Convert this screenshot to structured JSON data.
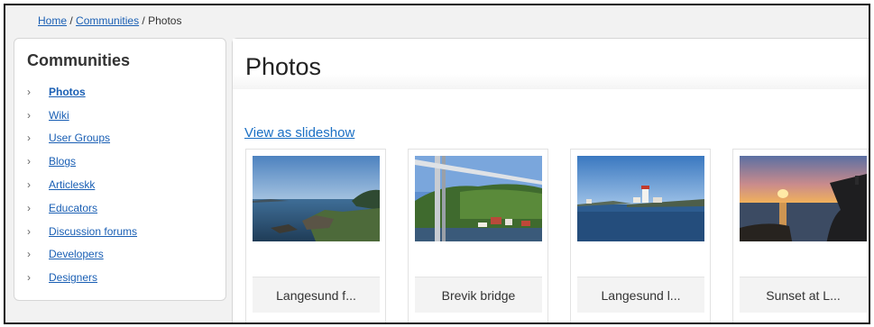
{
  "breadcrumb": {
    "home": "Home",
    "sep1": "/",
    "communities": "Communities",
    "sep2": "/",
    "current": "Photos"
  },
  "sidebar": {
    "title": "Communities",
    "items": [
      {
        "label": "Photos",
        "active": true
      },
      {
        "label": "Wiki"
      },
      {
        "label": "User Groups"
      },
      {
        "label": "Blogs"
      },
      {
        "label": "Articleskk"
      },
      {
        "label": "Educators"
      },
      {
        "label": "Discussion forums"
      },
      {
        "label": "Developers"
      },
      {
        "label": "Designers"
      }
    ],
    "chevron": "›"
  },
  "main": {
    "title": "Photos",
    "slideshow_link": "View as slideshow",
    "photos": [
      {
        "caption": "Langesund f..."
      },
      {
        "caption": "Brevik bridge"
      },
      {
        "caption": "Langesund l..."
      },
      {
        "caption": "Sunset at L..."
      }
    ]
  },
  "colors": {
    "link": "#1a5fb4",
    "panel_border": "#d6d6d6",
    "frame": "#111111"
  }
}
